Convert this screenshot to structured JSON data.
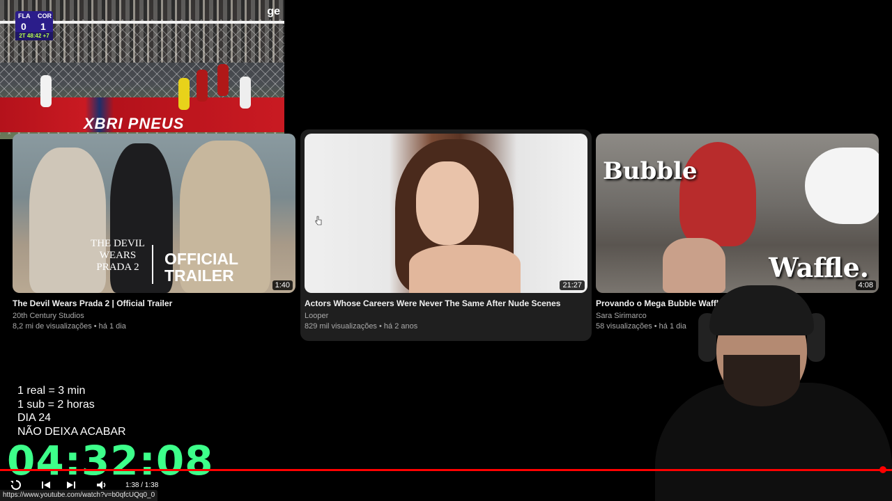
{
  "match_overlay": {
    "home_team": "FLA",
    "away_team": "COR",
    "home_score": "0",
    "away_score": "1",
    "clock": "2T 48:42 +7",
    "channel_logo": "ge",
    "ad_text": "XBRI PNEUS"
  },
  "videos": [
    {
      "title": "The Devil Wears Prada 2 | Official Trailer",
      "channel": "20th Century Studios",
      "meta": "8,2 mi de visualizações • há 1 dia",
      "duration": "1:40",
      "thumb_brand": "THE DEVIL WEARS PRADA 2",
      "thumb_label_1": "OFFICIAL",
      "thumb_label_2": "TRAILER"
    },
    {
      "title": "Actors Whose Careers Were Never The Same After Nude Scenes",
      "channel": "Looper",
      "meta": "829 mil visualizações • há 2 anos",
      "duration": "21:27"
    },
    {
      "title": "Provando o Mega Bubble Waffle",
      "channel": "Sara Sirimarco",
      "meta": "58 visualizações • há 1 dia",
      "duration": "4:08",
      "thumb_text_top": "Bubble",
      "thumb_text_bottom": "Waffle."
    }
  ],
  "stream_overlay": {
    "line1": "1 real = 3 min",
    "line2": "1 sub = 2 horas",
    "line3": "DIA 24",
    "line4": "NÃO DEIXA ACABAR",
    "timer": "04:32:08"
  },
  "player": {
    "progress_fraction": 0.99,
    "time_display": "1:38 / 1:38",
    "replay_icon": "replay-icon",
    "prev_icon": "previous-icon",
    "next_icon": "next-icon",
    "volume_icon": "volume-icon"
  },
  "status_bar": {
    "url": "https://www.youtube.com/watch?v=b0qfcUQq0_0"
  },
  "colors": {
    "progress": "#ff0000",
    "timer": "#3dff8a",
    "background": "#000000"
  }
}
